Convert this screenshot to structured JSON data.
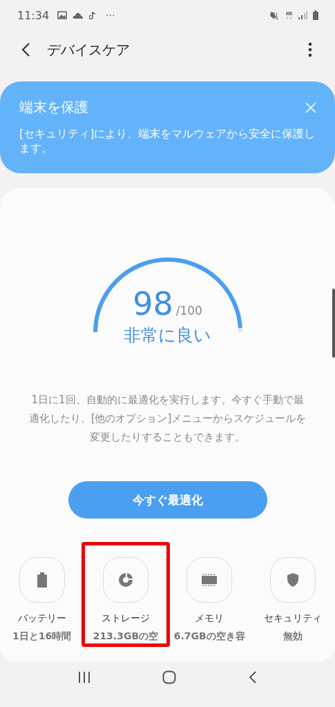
{
  "status_bar": {
    "time": "11:34",
    "more": "···"
  },
  "toolbar": {
    "title": "デバイスケア"
  },
  "banner": {
    "title": "端末を保護",
    "text": "[セキュリティ]により、端末をマルウェアから安全に保護します。"
  },
  "score": {
    "value": "98",
    "max": "/100",
    "rating": "非常に良い"
  },
  "description": "1日に1回、自動的に最適化を実行します。今すぐ手動で最適化したり、[他のオプション]メニューからスケジュールを変更したりすることもできます。",
  "optimize_button": "今すぐ最適化",
  "items": [
    {
      "kind": "battery",
      "label": "バッテリー",
      "value": "1日と16時間",
      "highlighted": false
    },
    {
      "kind": "storage",
      "label": "ストレージ",
      "value": "213.3GBの空",
      "highlighted": true
    },
    {
      "kind": "memory",
      "label": "メモリ",
      "value": "6.7GBの空き容",
      "highlighted": false
    },
    {
      "kind": "security",
      "label": "セキュリティ",
      "value": "無効",
      "highlighted": false
    }
  ]
}
